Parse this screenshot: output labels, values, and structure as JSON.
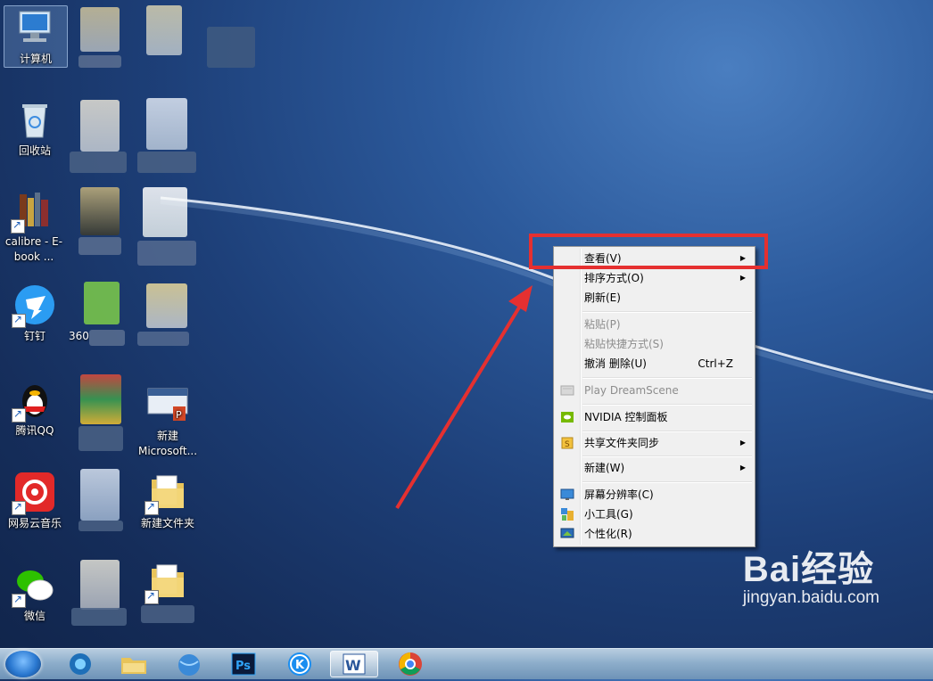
{
  "desktop": {
    "icons": [
      {
        "label": "计算机"
      },
      {
        "label": "回收站"
      },
      {
        "label": "calibre - E-book ..."
      },
      {
        "label": "钉钉"
      },
      {
        "label": "腾讯QQ"
      },
      {
        "label": "网易云音乐"
      },
      {
        "label": "微信"
      },
      {
        "label": "360"
      },
      {
        "label": "新建 Microsoft..."
      },
      {
        "label": "新建文件夹"
      }
    ]
  },
  "context_menu": {
    "items": [
      {
        "label": "查看(V)",
        "submenu": true,
        "disabled": false
      },
      {
        "label": "排序方式(O)",
        "submenu": true,
        "disabled": false
      },
      {
        "label": "刷新(E)",
        "disabled": false
      },
      {
        "label": "粘贴(P)",
        "disabled": true
      },
      {
        "label": "粘贴快捷方式(S)",
        "disabled": true
      },
      {
        "label": "撤消 删除(U)",
        "shortcut": "Ctrl+Z",
        "disabled": false
      },
      {
        "label": "Play DreamScene",
        "disabled": true
      },
      {
        "label": "NVIDIA 控制面板",
        "disabled": false
      },
      {
        "label": "共享文件夹同步",
        "submenu": true,
        "disabled": false
      },
      {
        "label": "新建(W)",
        "submenu": true,
        "disabled": false
      },
      {
        "label": "屏幕分辨率(C)",
        "disabled": false
      },
      {
        "label": "小工具(G)",
        "disabled": false
      },
      {
        "label": "个性化(R)",
        "disabled": false
      }
    ],
    "submenu_arrow": "▶"
  },
  "taskbar": {
    "apps": [
      "windows-start",
      "media-player",
      "file-explorer",
      "network-globe",
      "photoshop",
      "kugou-music",
      "word",
      "chrome"
    ],
    "ps_label": "Ps",
    "word_label": "W",
    "kugou_label": "K"
  },
  "watermark": {
    "brand": "Bai经验",
    "url": "jingyan.baidu.com"
  },
  "colors": {
    "highlight_box": "#e53030",
    "arrow": "#e53030"
  }
}
